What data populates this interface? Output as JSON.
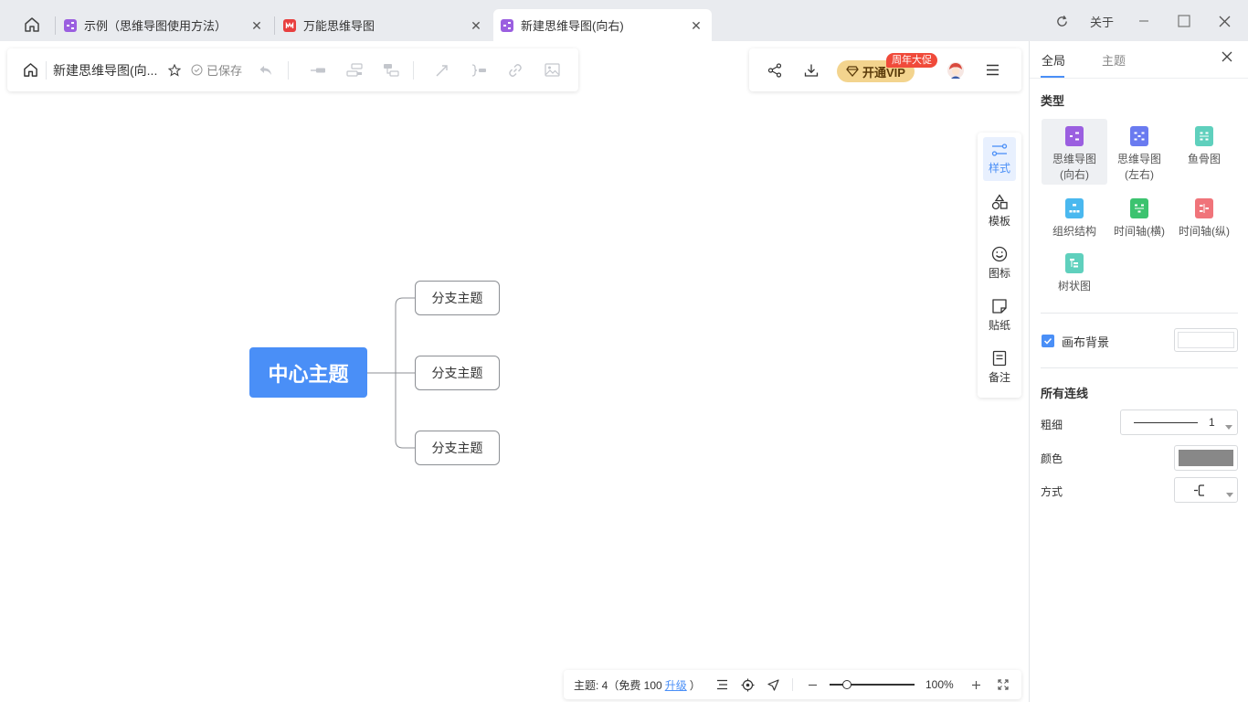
{
  "tabs": [
    {
      "label": "示例（思维导图使用方法）",
      "icon": "mindmap-icon",
      "color": "#9b5fe0"
    },
    {
      "label": "万能思维导图",
      "icon": "app-logo-icon",
      "color": "#e83f3f"
    },
    {
      "label": "新建思维导图(向右)",
      "icon": "mindmap-icon",
      "color": "#9b5fe0",
      "active": true
    }
  ],
  "window": {
    "about": "关于"
  },
  "toolbar": {
    "doc_title": "新建思维导图(向...",
    "saved_status": "已保存"
  },
  "vip": {
    "label": "开通VIP",
    "badge": "周年大促",
    "color": "#f3d48e"
  },
  "mindmap": {
    "center": "中心主题",
    "branches": [
      "分支主题",
      "分支主题",
      "分支主题"
    ],
    "center_color": "#4a8ff7"
  },
  "sidetools": [
    {
      "label": "样式",
      "icon": "style-icon",
      "active": true
    },
    {
      "label": "模板",
      "icon": "template-icon"
    },
    {
      "label": "图标",
      "icon": "emoji-icon"
    },
    {
      "label": "贴纸",
      "icon": "sticker-icon"
    },
    {
      "label": "备注",
      "icon": "note-icon"
    }
  ],
  "statusbar": {
    "topic_count": "主题: 4（免费 100",
    "upgrade": "升级",
    "close_paren": "）",
    "zoom": "100%",
    "zoom_level": 0.2
  },
  "panel": {
    "tabs": [
      "全局",
      "主题"
    ],
    "type_title": "类型",
    "types": [
      {
        "label": "思维导图\n(向右)",
        "line1": "思维导图",
        "line2": "(向右)",
        "color": "#9b5fe0",
        "active": true
      },
      {
        "label": "思维导图\n(左右)",
        "line1": "思维导图",
        "line2": "(左右)",
        "color": "#6a7bf0"
      },
      {
        "label": "鱼骨图",
        "line1": "鱼骨图",
        "line2": "",
        "color": "#5fd0bd"
      },
      {
        "label": "组织结构",
        "line1": "组织结构",
        "line2": "",
        "color": "#4ab8ef"
      },
      {
        "label": "时间轴(横)",
        "line1": "时间轴(横)",
        "line2": "",
        "color": "#3cc36f"
      },
      {
        "label": "时间轴(纵)",
        "line1": "时间轴(纵)",
        "line2": "",
        "color": "#f0747a"
      },
      {
        "label": "树状图",
        "line1": "树状图",
        "line2": "",
        "color": "#5fd0bd"
      }
    ],
    "canvas_bg_label": "画布背景",
    "canvas_bg_checked": true,
    "lines_title": "所有连线",
    "thickness_label": "粗细",
    "thickness_value": "1",
    "color_label": "颜色",
    "line_color": "#888888",
    "style_label": "方式"
  }
}
